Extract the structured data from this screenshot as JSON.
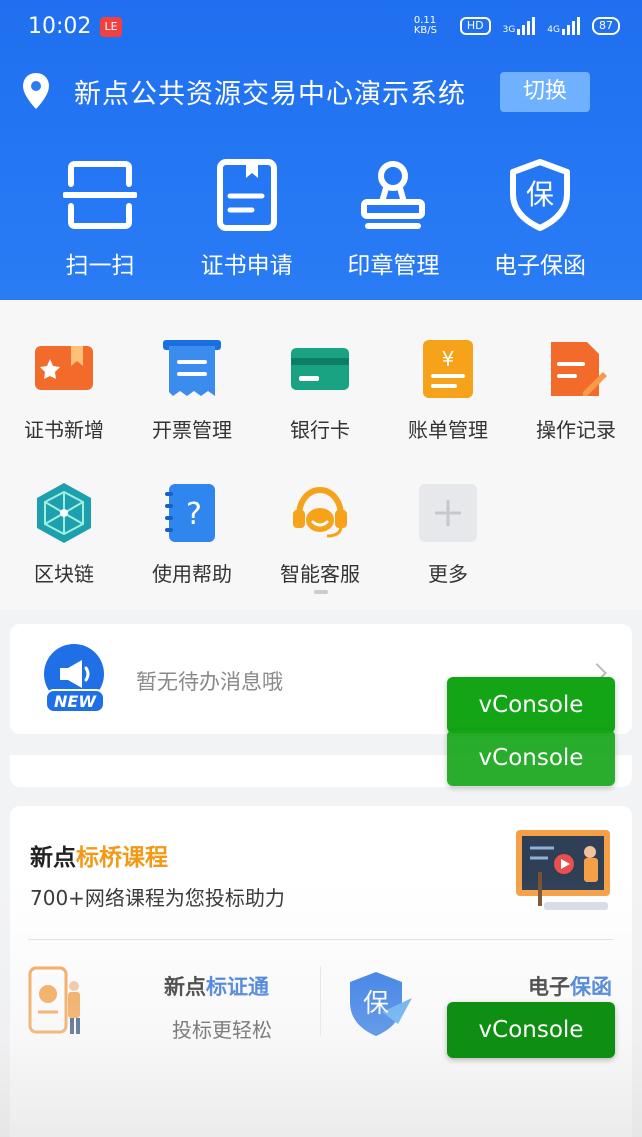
{
  "status_bar": {
    "time": "10:02",
    "notification": "LE",
    "net_speed": "0.11 KB/S",
    "hd": "HD",
    "sig1": "3G",
    "sig2": "4G",
    "battery": "87"
  },
  "header": {
    "title": "新点公共资源交易中心演示系统",
    "switch_label": "切换",
    "actions": [
      {
        "label": "扫一扫",
        "icon": "scan-icon"
      },
      {
        "label": "证书申请",
        "icon": "certificate-icon"
      },
      {
        "label": "印章管理",
        "icon": "stamp-icon"
      },
      {
        "label": "电子保函",
        "icon": "guarantee-shield-icon"
      }
    ]
  },
  "grid": {
    "row1": [
      {
        "label": "证书新增",
        "icon": "certificate-add-icon"
      },
      {
        "label": "开票管理",
        "icon": "invoice-icon"
      },
      {
        "label": "银行卡",
        "icon": "bank-card-icon"
      },
      {
        "label": "账单管理",
        "icon": "bill-icon"
      },
      {
        "label": "操作记录",
        "icon": "operation-record-icon"
      }
    ],
    "row2": [
      {
        "label": "区块链",
        "icon": "blockchain-icon"
      },
      {
        "label": "使用帮助",
        "icon": "help-icon"
      },
      {
        "label": "智能客服",
        "icon": "customer-service-icon"
      },
      {
        "label": "更多",
        "icon": "more-plus-icon"
      }
    ]
  },
  "notice": {
    "badge": "NEW",
    "text": "暂无待办消息哦"
  },
  "course": {
    "title_prefix": "新点",
    "title_highlight": "标桥课程",
    "subtitle": "700+网络课程为您投标助力"
  },
  "promo_left": {
    "title_prefix": "新点",
    "title_highlight": "标证通",
    "subtitle": "投标更轻松"
  },
  "promo_right": {
    "title_prefix": "电子",
    "title_highlight": "保函",
    "icon_text": "保"
  },
  "vconsole": {
    "label": "vConsole"
  },
  "colors": {
    "header_blue": "#1f6ff0",
    "accent_orange": "#f29a17",
    "accent_blue": "#2b6fd6",
    "vconsole_green": "#13a516"
  }
}
